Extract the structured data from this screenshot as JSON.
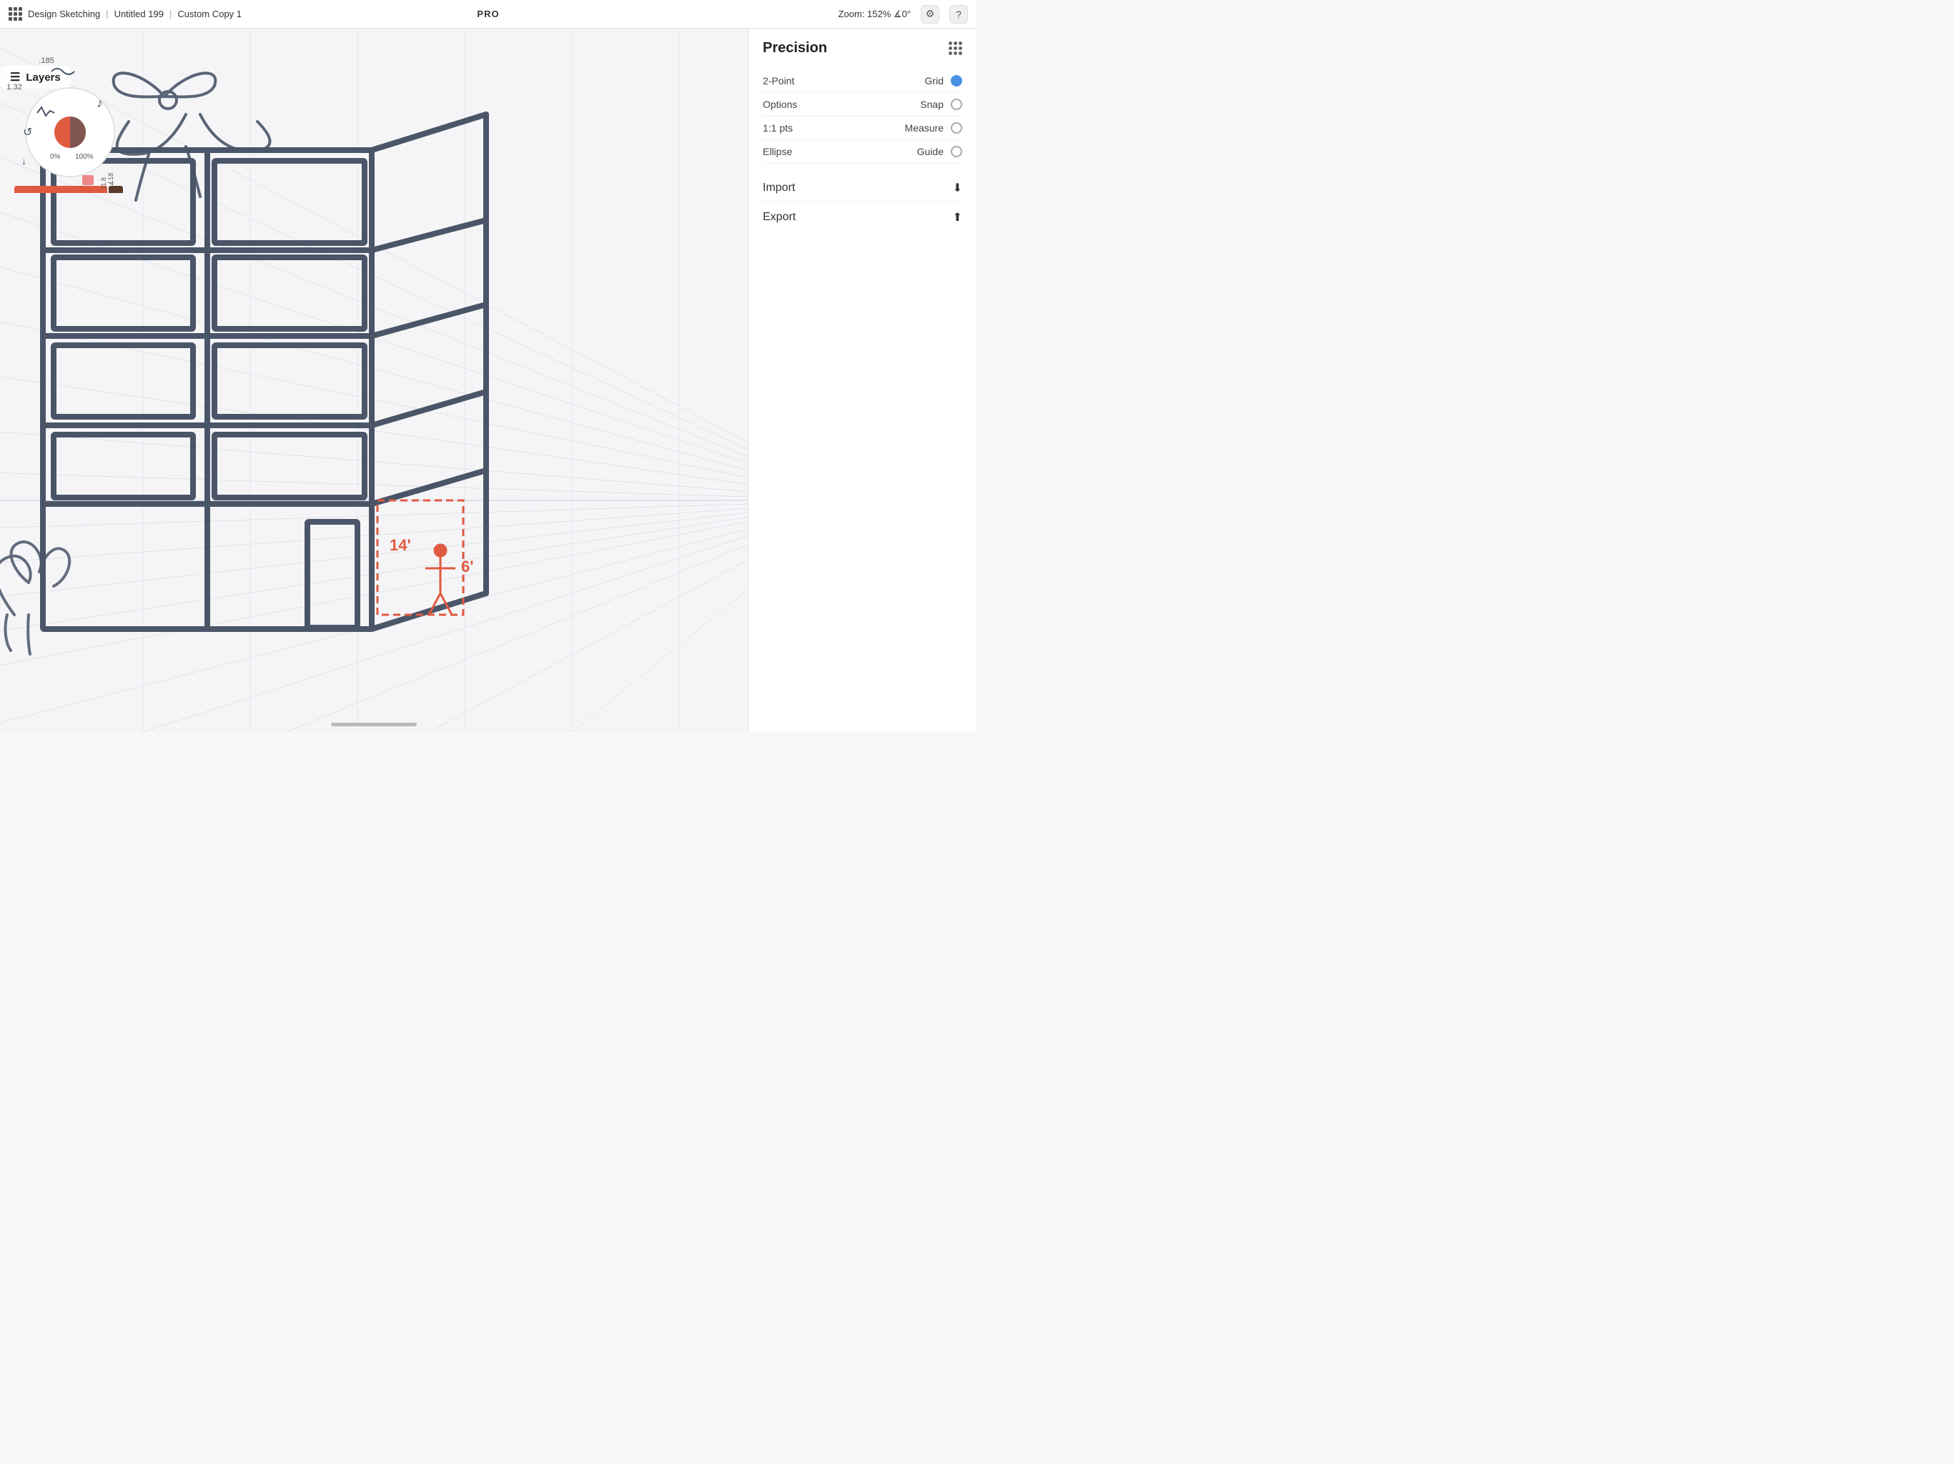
{
  "topbar": {
    "app_name": "Design Sketching",
    "separator1": "|",
    "file_name": "Untitled 199",
    "separator2": "|",
    "copy_name": "Custom Copy 1",
    "pro_label": "PRO",
    "zoom_label": "Zoom: 152% ∡0°",
    "settings_icon": "⚙",
    "help_icon": "?"
  },
  "panel": {
    "title": "Precision",
    "dots_icon": "grid",
    "row1": {
      "label1": "2-Point",
      "label2": "Grid",
      "radio": "filled"
    },
    "row2": {
      "label1": "Options",
      "label2": "Snap",
      "radio": "empty"
    },
    "row3": {
      "label1": "1:1 pts",
      "label2": "Measure",
      "radio": "empty"
    },
    "row4": {
      "label1": "Ellipse",
      "label2": "Guide",
      "radio": "empty"
    },
    "import_label": "Import",
    "export_label": "Export"
  },
  "layers": {
    "label": "Layers"
  },
  "canvas": {
    "annotations": [
      "14'",
      "6'"
    ]
  }
}
